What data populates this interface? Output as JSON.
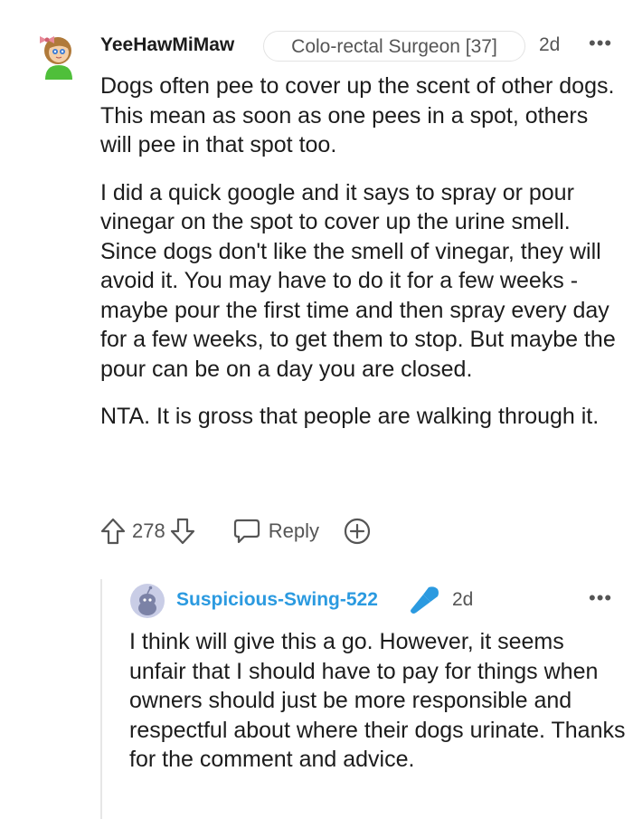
{
  "top_comment": {
    "author": "YeeHawMiMaw",
    "flair": "Colo-rectal Surgeon [37]",
    "time": "2d",
    "more": "•••",
    "paragraphs": [
      "Dogs often pee to cover up the scent of other dogs. This mean as soon as one pees in a spot, others will pee in that spot too.",
      "I did a quick google and it says to spray or pour vinegar on the spot to cover up the urine smell. Since dogs don't like the smell of vinegar, they will avoid it. You may have to do it for a few weeks - maybe pour the first time and then spray every day for a few weeks, to get them to stop. But maybe the pour can be on a day you are closed.",
      "NTA. It is gross that people are walking through it."
    ],
    "votes": "278",
    "reply_label": "Reply",
    "icons": [
      "avatar",
      "upvote-icon",
      "downvote-icon",
      "reply-icon",
      "award-icon",
      "more-icon"
    ]
  },
  "reply_comment": {
    "author": "Suspicious-Swing-522",
    "time": "2d",
    "more": "•••",
    "body": "I think will give this a go. However, it seems unfair that I should have to pay for things when owners should just be more responsible and respectful about where their dogs urinate. Thanks for the comment and advice.",
    "icons": [
      "avatar",
      "microphone-icon",
      "more-icon"
    ]
  },
  "colors": {
    "text": "#1c1c1c",
    "muted": "#555555",
    "reply_author": "#2b9ae0",
    "mic": "#2b9ae0",
    "thread_line": "#e6e6e6"
  }
}
